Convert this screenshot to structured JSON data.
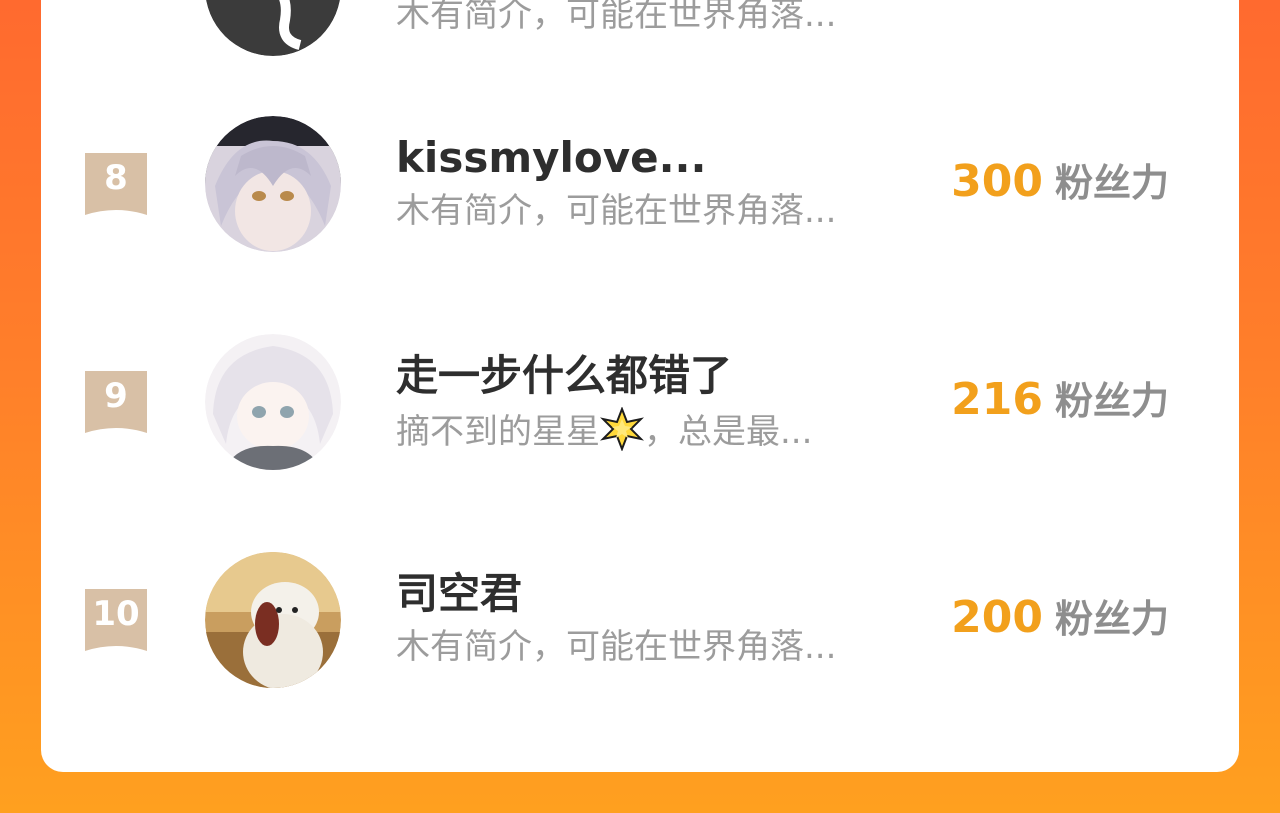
{
  "colors": {
    "background_gradient": [
      "#ff6a2f",
      "#ffa01f"
    ],
    "card": "#ffffff",
    "name": "#2e2e2e",
    "bio": "#9c9c9c",
    "fans_count": "#f2a01c",
    "fans_label": "#8e8e8e",
    "rank_ribbon": "#d8c0a6"
  },
  "rows": [
    {
      "rank": "",
      "name": "",
      "bio": "木有简介，可能在世界角落...",
      "fans_count": "",
      "fans_label": "",
      "avatar_icon": "dark-avatar"
    },
    {
      "rank": "8",
      "name": "kissmylove...",
      "bio": "木有简介，可能在世界角落...",
      "fans_count": "300",
      "fans_label": "粉丝力",
      "avatar_icon": "anime-girl-avatar"
    },
    {
      "rank": "9",
      "name": "走一步什么都错了",
      "bio_before": "摘不到的星星",
      "bio_emoji": "sparkle-star-icon",
      "bio_after": "，总是最...",
      "fans_count": "216",
      "fans_label": "粉丝力",
      "avatar_icon": "white-hair-girl-avatar"
    },
    {
      "rank": "10",
      "name": "司空君",
      "bio": "木有简介，可能在世界角落...",
      "fans_count": "200",
      "fans_label": "粉丝力",
      "avatar_icon": "baymax-avatar"
    }
  ]
}
